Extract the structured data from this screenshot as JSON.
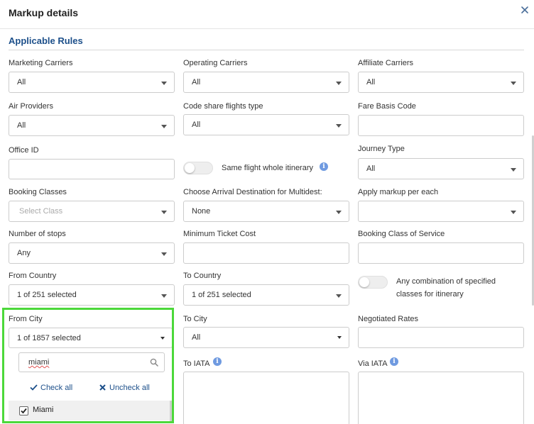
{
  "modal": {
    "title": "Markup details",
    "close_icon": "close-icon"
  },
  "section": {
    "title": "Applicable Rules"
  },
  "fields": {
    "marketing_carriers": {
      "label": "Marketing Carriers",
      "value": "All"
    },
    "operating_carriers": {
      "label": "Operating Carriers",
      "value": "All"
    },
    "affiliate_carriers": {
      "label": "Affiliate Carriers",
      "value": "All"
    },
    "air_providers": {
      "label": "Air Providers",
      "value": "All"
    },
    "code_share": {
      "label": "Code share flights type",
      "value": "All"
    },
    "fare_basis": {
      "label": "Fare Basis Code",
      "value": ""
    },
    "office_id": {
      "label": "Office ID",
      "value": ""
    },
    "same_flight": {
      "label": "Same flight whole itinerary",
      "enabled": false
    },
    "journey_type": {
      "label": "Journey Type",
      "value": "All"
    },
    "booking_classes": {
      "label": "Booking Classes",
      "placeholder": "Select Class"
    },
    "arrival_destination": {
      "label": "Choose Arrival Destination for Multidest:",
      "value": "None"
    },
    "apply_markup": {
      "label": "Apply markup per each",
      "value": ""
    },
    "number_of_stops": {
      "label": "Number of stops",
      "value": "Any"
    },
    "min_ticket_cost": {
      "label": "Minimum Ticket Cost",
      "value": ""
    },
    "booking_class_service": {
      "label": "Booking Class of Service",
      "value": ""
    },
    "from_country": {
      "label": "From Country",
      "value": "1 of 251 selected"
    },
    "to_country": {
      "label": "To Country",
      "value": "1 of 251 selected"
    },
    "any_combination": {
      "label_line1": "Any combination of specified",
      "label_line2": "classes for itinerary",
      "enabled": false
    },
    "from_city": {
      "label": "From City",
      "value": "1 of 1857 selected",
      "search_value": "miami",
      "check_all": "Check all",
      "uncheck_all": "Uncheck all",
      "options": [
        {
          "label": "Miami",
          "checked": true
        }
      ]
    },
    "to_city": {
      "label": "To City",
      "value": "All"
    },
    "negotiated_rates": {
      "label": "Negotiated Rates",
      "value": ""
    },
    "to_iata": {
      "label": "To IATA"
    },
    "via_iata": {
      "label": "Via IATA"
    }
  },
  "colors": {
    "accent": "#1c4f8a",
    "highlight": "#4cd83a",
    "info": "#6f9ae0"
  }
}
